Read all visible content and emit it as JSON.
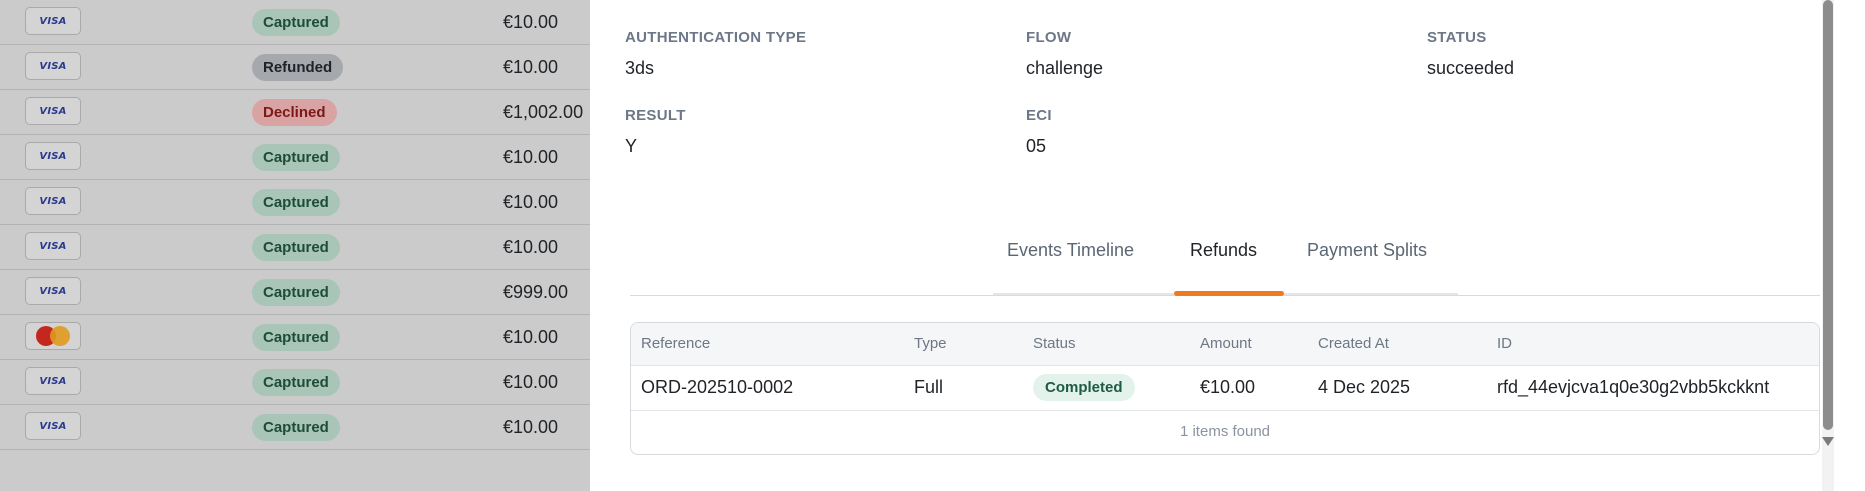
{
  "transactions": [
    {
      "card": "visa",
      "card_label": "VISA",
      "status": "Captured",
      "status_kind": "captured",
      "amount": "€10.00"
    },
    {
      "card": "visa",
      "card_label": "VISA",
      "status": "Refunded",
      "status_kind": "refunded",
      "amount": "€10.00"
    },
    {
      "card": "visa",
      "card_label": "VISA",
      "status": "Declined",
      "status_kind": "declined",
      "amount": "€1,002.00"
    },
    {
      "card": "visa",
      "card_label": "VISA",
      "status": "Captured",
      "status_kind": "captured",
      "amount": "€10.00"
    },
    {
      "card": "visa",
      "card_label": "VISA",
      "status": "Captured",
      "status_kind": "captured",
      "amount": "€10.00"
    },
    {
      "card": "visa",
      "card_label": "VISA",
      "status": "Captured",
      "status_kind": "captured",
      "amount": "€10.00"
    },
    {
      "card": "visa",
      "card_label": "VISA",
      "status": "Captured",
      "status_kind": "captured",
      "amount": "€999.00"
    },
    {
      "card": "mastercard",
      "card_label": "",
      "status": "Captured",
      "status_kind": "captured",
      "amount": "€10.00"
    },
    {
      "card": "visa",
      "card_label": "VISA",
      "status": "Captured",
      "status_kind": "captured",
      "amount": "€10.00"
    },
    {
      "card": "visa",
      "card_label": "VISA",
      "status": "Captured",
      "status_kind": "captured",
      "amount": "€10.00"
    }
  ],
  "authentication": {
    "auth_type_label": "AUTHENTICATION TYPE",
    "auth_type_value": "3ds",
    "flow_label": "FLOW",
    "flow_value": "challenge",
    "status_label": "STATUS",
    "status_value": "succeeded",
    "result_label": "RESULT",
    "result_value": "Y",
    "eci_label": "ECI",
    "eci_value": "05"
  },
  "tabs": [
    {
      "label": "Events Timeline",
      "active": false
    },
    {
      "label": "Refunds",
      "active": true
    },
    {
      "label": "Payment Splits",
      "active": false
    }
  ],
  "refunds_table": {
    "columns": [
      "Reference",
      "Type",
      "Status",
      "Amount",
      "Created At",
      "ID"
    ],
    "rows": [
      {
        "reference": "ORD-202510-0002",
        "type": "Full",
        "status": "Completed",
        "amount": "€10.00",
        "created_at": "4 Dec 2025",
        "id": "rfd_44evjcva1q0e30g2vbb5kckknt"
      }
    ],
    "footer": "1 items found"
  },
  "colors": {
    "accent_tab": "#f07a1e",
    "overlay": "#cbcbcb",
    "captured_bg": "#a9c5b7",
    "declined_bg": "#d9a3a3",
    "completed_bg": "#e3f3ec"
  },
  "icons": {
    "visa": "visa-card-icon",
    "mastercard": "mastercard-icon",
    "scroll_down": "scroll-down-arrow-icon"
  }
}
